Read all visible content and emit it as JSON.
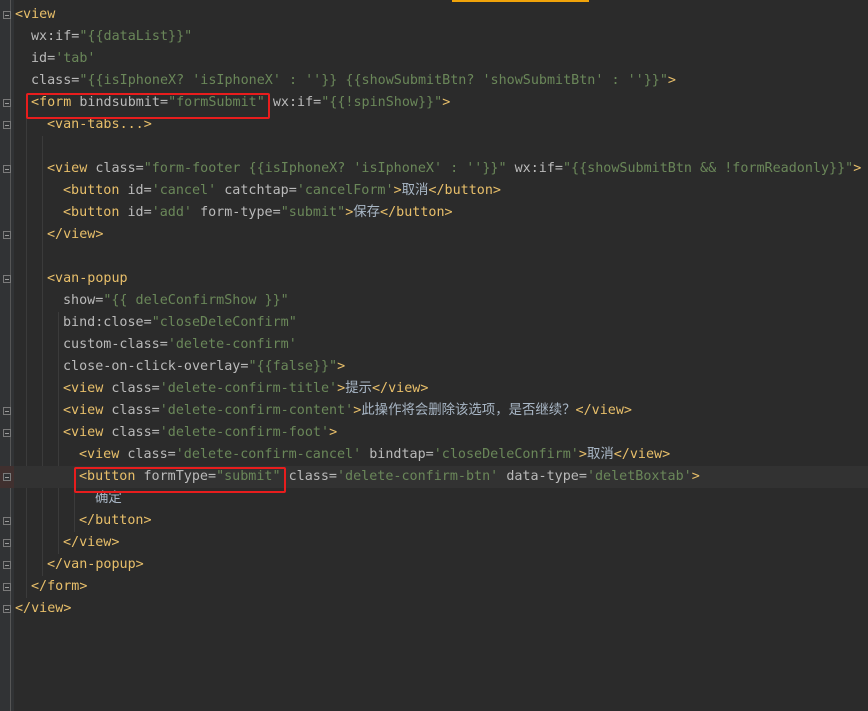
{
  "editor": {
    "lines": [
      {
        "indent": 0,
        "tokens": [
          [
            "tag",
            "<view"
          ]
        ]
      },
      {
        "indent": 1,
        "tokens": [
          [
            "attr",
            "wx:if="
          ],
          [
            "val",
            "\"{{dataList}}\""
          ]
        ]
      },
      {
        "indent": 1,
        "tokens": [
          [
            "attr",
            "id="
          ],
          [
            "val",
            "'tab'"
          ]
        ]
      },
      {
        "indent": 1,
        "tokens": [
          [
            "attr",
            "class="
          ],
          [
            "val",
            "\"{{isIphoneX? 'isIphoneX' : ''}} {{showSubmitBtn? 'showSubmitBtn' : ''}}\""
          ],
          [
            "tag",
            ">"
          ]
        ]
      },
      {
        "indent": 1,
        "tokens": [
          [
            "tag",
            "<form "
          ],
          [
            "attr",
            "bindsubmit="
          ],
          [
            "val",
            "\"formSubmit\""
          ],
          [
            "text",
            " "
          ],
          [
            "attr",
            "wx:if="
          ],
          [
            "val",
            "\"{{!spinShow}}\""
          ],
          [
            "tag",
            ">"
          ]
        ]
      },
      {
        "indent": 2,
        "tokens": [
          [
            "tag",
            "<van-tabs"
          ],
          [
            "tag",
            "...>"
          ]
        ]
      },
      {
        "indent": 0,
        "tokens": []
      },
      {
        "indent": 2,
        "tokens": [
          [
            "tag",
            "<view "
          ],
          [
            "attr",
            "class="
          ],
          [
            "val",
            "\"form-footer {{isIphoneX? 'isIphoneX' : ''}}\""
          ],
          [
            "text",
            " "
          ],
          [
            "attr",
            "wx:if="
          ],
          [
            "val",
            "\"{{showSubmitBtn && !formReadonly}}\""
          ],
          [
            "tag",
            ">"
          ]
        ]
      },
      {
        "indent": 3,
        "tokens": [
          [
            "tag",
            "<button "
          ],
          [
            "attr",
            "id="
          ],
          [
            "val",
            "'cancel'"
          ],
          [
            "text",
            " "
          ],
          [
            "attr",
            "catchtap="
          ],
          [
            "val",
            "'cancelForm'"
          ],
          [
            "tag",
            ">"
          ],
          [
            "text",
            "取消"
          ],
          [
            "tag",
            "</button>"
          ]
        ]
      },
      {
        "indent": 3,
        "tokens": [
          [
            "tag",
            "<button "
          ],
          [
            "attr",
            "id="
          ],
          [
            "val",
            "'add'"
          ],
          [
            "text",
            " "
          ],
          [
            "attr",
            "form-type="
          ],
          [
            "val",
            "\"submit\""
          ],
          [
            "tag",
            ">"
          ],
          [
            "text",
            "保存"
          ],
          [
            "tag",
            "</button>"
          ]
        ]
      },
      {
        "indent": 2,
        "tokens": [
          [
            "tag",
            "</view>"
          ]
        ]
      },
      {
        "indent": 0,
        "tokens": []
      },
      {
        "indent": 2,
        "tokens": [
          [
            "tag",
            "<van-popup"
          ]
        ]
      },
      {
        "indent": 3,
        "tokens": [
          [
            "attr",
            "show="
          ],
          [
            "val",
            "\"{{ deleConfirmShow }}\""
          ]
        ]
      },
      {
        "indent": 3,
        "tokens": [
          [
            "attr",
            "bind:close="
          ],
          [
            "val",
            "\"closeDeleConfirm\""
          ]
        ]
      },
      {
        "indent": 3,
        "tokens": [
          [
            "attr",
            "custom-class="
          ],
          [
            "val",
            "'delete-confirm'"
          ]
        ]
      },
      {
        "indent": 3,
        "tokens": [
          [
            "attr",
            "close-on-click-overlay="
          ],
          [
            "val",
            "\"{{false}}\""
          ],
          [
            "tag",
            ">"
          ]
        ]
      },
      {
        "indent": 3,
        "tokens": [
          [
            "tag",
            "<view "
          ],
          [
            "attr",
            "class="
          ],
          [
            "val",
            "'delete-confirm-title'"
          ],
          [
            "tag",
            ">"
          ],
          [
            "text",
            "提示"
          ],
          [
            "tag",
            "</view>"
          ]
        ]
      },
      {
        "indent": 3,
        "tokens": [
          [
            "tag",
            "<view "
          ],
          [
            "attr",
            "class="
          ],
          [
            "val",
            "'delete-confirm-content'"
          ],
          [
            "tag",
            ">"
          ],
          [
            "text",
            "此操作将会删除该选项，是否继续？"
          ],
          [
            "tag",
            "</view>"
          ]
        ]
      },
      {
        "indent": 3,
        "tokens": [
          [
            "tag",
            "<view "
          ],
          [
            "attr",
            "class="
          ],
          [
            "val",
            "'delete-confirm-foot'"
          ],
          [
            "tag",
            ">"
          ]
        ]
      },
      {
        "indent": 4,
        "tokens": [
          [
            "tag",
            "<view "
          ],
          [
            "attr",
            "class="
          ],
          [
            "val",
            "'delete-confirm-cancel'"
          ],
          [
            "text",
            " "
          ],
          [
            "attr",
            "bindtap="
          ],
          [
            "val",
            "'closeDeleConfirm'"
          ],
          [
            "tag",
            ">"
          ],
          [
            "text",
            "取消"
          ],
          [
            "tag",
            "</view>"
          ]
        ]
      },
      {
        "indent": 4,
        "tokens": [
          [
            "tag",
            "<button "
          ],
          [
            "attr",
            "formType="
          ],
          [
            "val",
            "\"submit\""
          ],
          [
            "text",
            " "
          ],
          [
            "attr",
            "class="
          ],
          [
            "val",
            "'delete-confirm-btn'"
          ],
          [
            "text",
            " "
          ],
          [
            "attr",
            "data-type="
          ],
          [
            "val",
            "'deletBoxtab'"
          ],
          [
            "tag",
            ">"
          ]
        ]
      },
      {
        "indent": 5,
        "tokens": [
          [
            "text",
            "确定"
          ]
        ]
      },
      {
        "indent": 4,
        "tokens": [
          [
            "tag",
            "</button>"
          ]
        ]
      },
      {
        "indent": 3,
        "tokens": [
          [
            "tag",
            "</view>"
          ]
        ]
      },
      {
        "indent": 2,
        "tokens": [
          [
            "tag",
            "</van-popup>"
          ]
        ]
      },
      {
        "indent": 1,
        "tokens": [
          [
            "tag",
            "</form>"
          ]
        ]
      },
      {
        "indent": 0,
        "tokens": [
          [
            "tag",
            "</view>"
          ]
        ]
      }
    ],
    "caret_line": 21,
    "fold_markers": [
      0,
      4,
      5,
      7,
      10,
      12,
      18,
      19,
      21,
      23,
      24,
      25,
      26,
      27
    ],
    "red_boxes": [
      {
        "line": 4,
        "from_token": 0,
        "to_token": 2
      },
      {
        "line": 21,
        "from_token": 0,
        "to_token": 2
      }
    ],
    "colors": {
      "tag": "#e8bf6a",
      "attr": "#bababa",
      "value": "#6a8759",
      "text": "#a9b7c6",
      "background": "#2b2b2b",
      "highlight_box": "#e81d1d"
    }
  }
}
